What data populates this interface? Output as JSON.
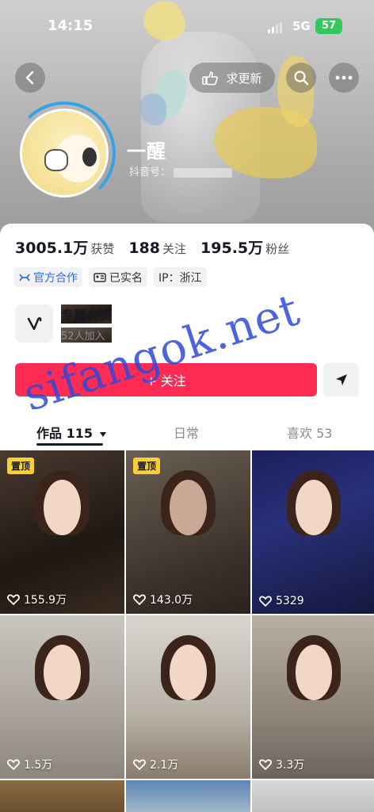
{
  "status_bar": {
    "time": "14:15",
    "network": "5G",
    "battery": "57"
  },
  "header": {
    "request_update_label": "求更新",
    "nickname": "一醒",
    "douyin_id_label": "抖音号："
  },
  "stats": {
    "likes_value": "3005.1万",
    "likes_label": "获赞",
    "following_value": "188",
    "following_label": "关注",
    "followers_value": "195.5万",
    "followers_label": "粉丝"
  },
  "tags": {
    "official": "官方合作",
    "verified": "已实名",
    "ip": "IP：浙江"
  },
  "member": {
    "title": "专属会员",
    "joined": "52人加入"
  },
  "actions": {
    "follow_label": "+ 关注"
  },
  "tabs": {
    "works": "作品 115",
    "daily": "日常",
    "likes": "喜欢 53"
  },
  "videos": [
    {
      "pinned": "置顶",
      "likes": "155.9万"
    },
    {
      "pinned": "置顶",
      "likes": "143.0万"
    },
    {
      "pinned": "",
      "likes": "5329"
    },
    {
      "pinned": "",
      "likes": "1.5万"
    },
    {
      "pinned": "",
      "likes": "2.1万"
    },
    {
      "pinned": "",
      "likes": "3.3万"
    }
  ],
  "watermark": "sifangok.net",
  "colors": {
    "follow_button": "#fe2c55",
    "pin_badge": "#facf31",
    "official_tag": "#2f6de1",
    "watermark": "#2e49d7"
  },
  "icons": [
    "back-icon",
    "hand-point-icon",
    "search-icon",
    "more-icon",
    "official-icon",
    "id-card-icon",
    "member-v-icon",
    "share-arrow-icon",
    "heart-icon"
  ]
}
